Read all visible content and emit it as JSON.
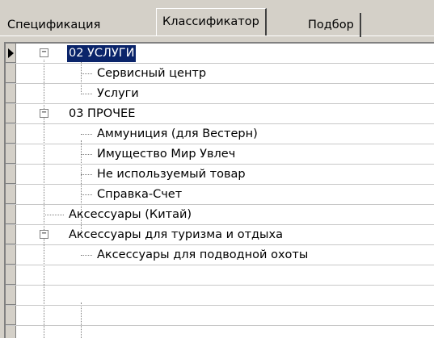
{
  "tabs": [
    {
      "label": "Спецификация"
    },
    {
      "label": "Классификатор"
    },
    {
      "label": "Подбор"
    }
  ],
  "tree": {
    "rows": [
      {
        "label": "02 УСЛУГИ"
      },
      {
        "label": "Сервисный центр"
      },
      {
        "label": "Услуги"
      },
      {
        "label": "03 ПРОЧЕЕ"
      },
      {
        "label": "Аммуниция (для Вестерн)"
      },
      {
        "label": "Имущество Мир Увлеч"
      },
      {
        "label": "Не используемый товар"
      },
      {
        "label": "Справка-Счет"
      },
      {
        "label": "Аксессуары  (Китай)"
      },
      {
        "label": "Аксессуары для туризма и отдыха"
      },
      {
        "label": "Аксессуары для подводной охоты"
      }
    ]
  },
  "colors": {
    "selection": "#0a246a",
    "face": "#d4d0c8"
  }
}
